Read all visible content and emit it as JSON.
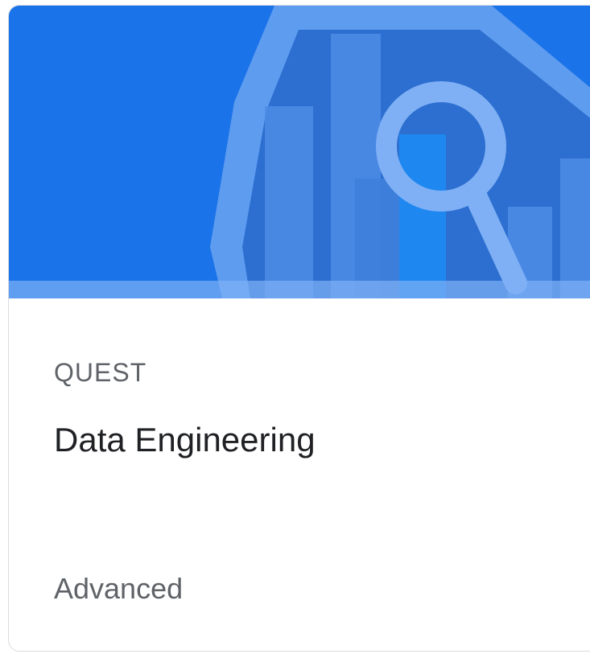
{
  "card": {
    "type_label": "QUEST",
    "title": "Data Engineering",
    "level": "Advanced"
  },
  "banner": {
    "icon": "magnifier-over-bar-chart-icon",
    "colors": {
      "background": "#1a73e8",
      "hexagon": "#5e9cf0",
      "hexagon_inner": "#2c6fd0",
      "bars": "#4d8de6",
      "highlight_bar": "#1e88f0"
    }
  }
}
